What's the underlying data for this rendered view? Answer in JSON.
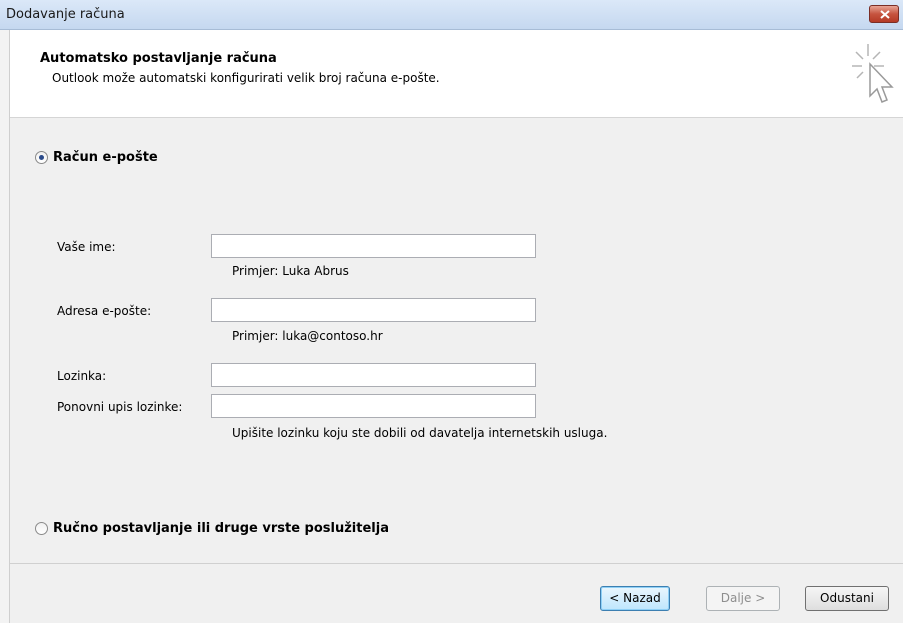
{
  "window": {
    "title": "Dodavanje računa"
  },
  "header": {
    "title": "Automatsko postavljanje računa",
    "subtitle": "Outlook može automatski konfigurirati velik broj računa e-pošte."
  },
  "options": {
    "email_account": "Račun e-pošte",
    "manual": "Ručno postavljanje ili druge vrste poslužitelja"
  },
  "form": {
    "name_label": "Vaše ime:",
    "name_value": "",
    "name_hint": "Primjer: Luka Abrus",
    "email_label": "Adresa e-pošte:",
    "email_value": "",
    "email_hint": "Primjer: luka@contoso.hr",
    "password_label": "Lozinka:",
    "password_value": "",
    "retype_label": "Ponovni upis lozinke:",
    "retype_value": "",
    "password_hint": "Upišite lozinku koju ste dobili od davatelja internetskih usluga."
  },
  "buttons": {
    "back": "< Nazad",
    "next": "Dalje >",
    "cancel": "Odustani"
  }
}
